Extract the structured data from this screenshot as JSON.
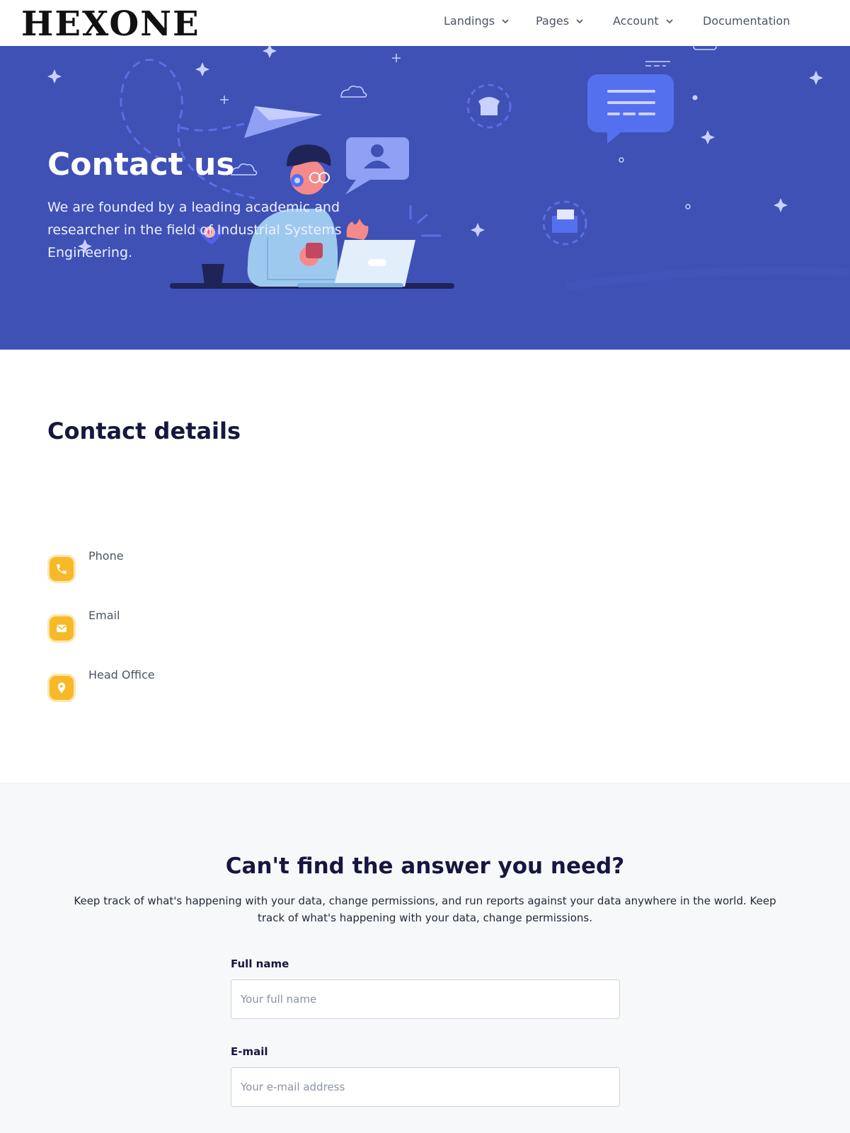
{
  "brand": {
    "logo_text": "HEXONE"
  },
  "nav": {
    "items": [
      {
        "label": "Landings",
        "has_dropdown": true
      },
      {
        "label": "Pages",
        "has_dropdown": true
      },
      {
        "label": "Account",
        "has_dropdown": true
      },
      {
        "label": "Documentation",
        "has_dropdown": false
      }
    ]
  },
  "hero": {
    "title": "Contact us",
    "subtitle": "We are founded by a leading academic and researcher in the field of Industrial Systems Engineering.",
    "background_color": "#3f51b5"
  },
  "contact": {
    "title": "Contact details",
    "items": [
      {
        "label": "Phone",
        "icon": "phone-icon"
      },
      {
        "label": "Email",
        "icon": "envelope-icon"
      },
      {
        "label": "Head Office",
        "icon": "map-pin-icon"
      }
    ],
    "icon_color": "#f7b928"
  },
  "help": {
    "title": "Can't find the answer you need?",
    "text": "Keep track of what's happening with your data, change permissions, and run reports against your data anywhere in the world. Keep track of what's happening with your data, change permissions."
  },
  "form": {
    "full_name": {
      "label": "Full name",
      "placeholder": "Your full name",
      "value": ""
    },
    "email": {
      "label": "E-mail",
      "placeholder": "Your e-mail address",
      "value": ""
    }
  }
}
